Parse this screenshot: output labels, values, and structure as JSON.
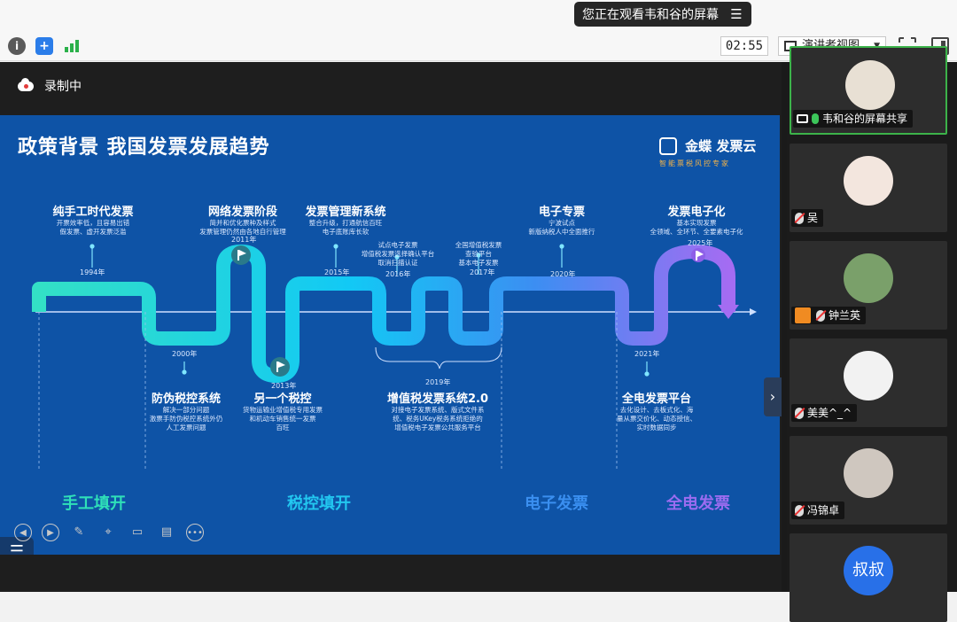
{
  "share_banner": {
    "text": "您正在观看韦和谷的屏幕",
    "menu_icon": "menu-icon"
  },
  "toolbar": {
    "timer": "02:55",
    "view_mode": "演讲者视图"
  },
  "recording": {
    "label": "录制中"
  },
  "slide": {
    "title": "政策背景  我国发票发展趋势",
    "brand_name": "金蝶 发票云",
    "brand_tagline": "智能票税风控专家",
    "milestones_top": [
      {
        "title": "纯手工时代发票",
        "desc1": "开票效率低，且容易出错",
        "desc2": "假发票、虚开发票泛滥",
        "year": "1994年"
      },
      {
        "title": "网络发票阶段",
        "desc1": "简并和优化票种及样式",
        "desc2": "发票管理仍然由各地自行管理",
        "year": "2011年"
      },
      {
        "title": "发票管理新系统",
        "desc1": "整合升级，打通航信百旺",
        "desc2": "电子底账库长软",
        "year": "2015年"
      },
      {
        "title": "试点电子发票",
        "desc1": "增值税发票选择确认平台",
        "desc2": "取消扫描认证",
        "year": "2016年"
      },
      {
        "title": "全国增值税发票",
        "desc1": "查验平台",
        "desc2": "基本电子发票",
        "year": "2017年"
      },
      {
        "title": "电子专票",
        "desc1": "宁波试点",
        "desc2": "新版纳税人中全面推行",
        "year": "2020年"
      },
      {
        "title": "发票电子化",
        "desc1": "基本实现发票",
        "desc2": "全领域、全环节、全要素电子化",
        "year": "2025年"
      }
    ],
    "milestones_bottom": [
      {
        "title": "防伪税控系统",
        "desc1": "解决一部分问题",
        "desc2": "激票手防伪税控系统外仍",
        "desc3": "人工发票问题",
        "year": "2000年"
      },
      {
        "title": "另一个税控",
        "desc1": "货物运输业增值税专用发票",
        "desc2": "和机动车销售统一发票",
        "desc3": "百旺",
        "year": "2013年"
      },
      {
        "title": "增值税发票系统2.0",
        "desc1": "对接电子发票系统、版式文件系",
        "desc2": "统、税务UKey税务系统拒绝的",
        "desc3": "增值税电子发票公共服务平台",
        "year": "2019年"
      },
      {
        "title": "全电发票平台",
        "desc1": "去化设计、去板式化、海",
        "desc2": "量从票交价化、动态授信、",
        "desc3": "实时数据同步",
        "year": "2021年"
      }
    ],
    "eras": [
      {
        "label": "手工填开",
        "color": "#2fe0b8"
      },
      {
        "label": "税控填开",
        "color": "#22c7f0"
      },
      {
        "label": "电子发票",
        "color": "#3a8ff0"
      },
      {
        "label": "全电发票",
        "color": "#9b6cf0"
      }
    ]
  },
  "participants": [
    {
      "name": "韦和谷的屏幕共享",
      "status": "sharing"
    },
    {
      "name": "吴",
      "status": "muted"
    },
    {
      "name": "钟兰英",
      "status": "muted"
    },
    {
      "name": "美美^_^",
      "status": "muted"
    },
    {
      "name": "冯锦卓",
      "status": "muted"
    },
    {
      "name": "叔叔",
      "status": "muted"
    }
  ]
}
